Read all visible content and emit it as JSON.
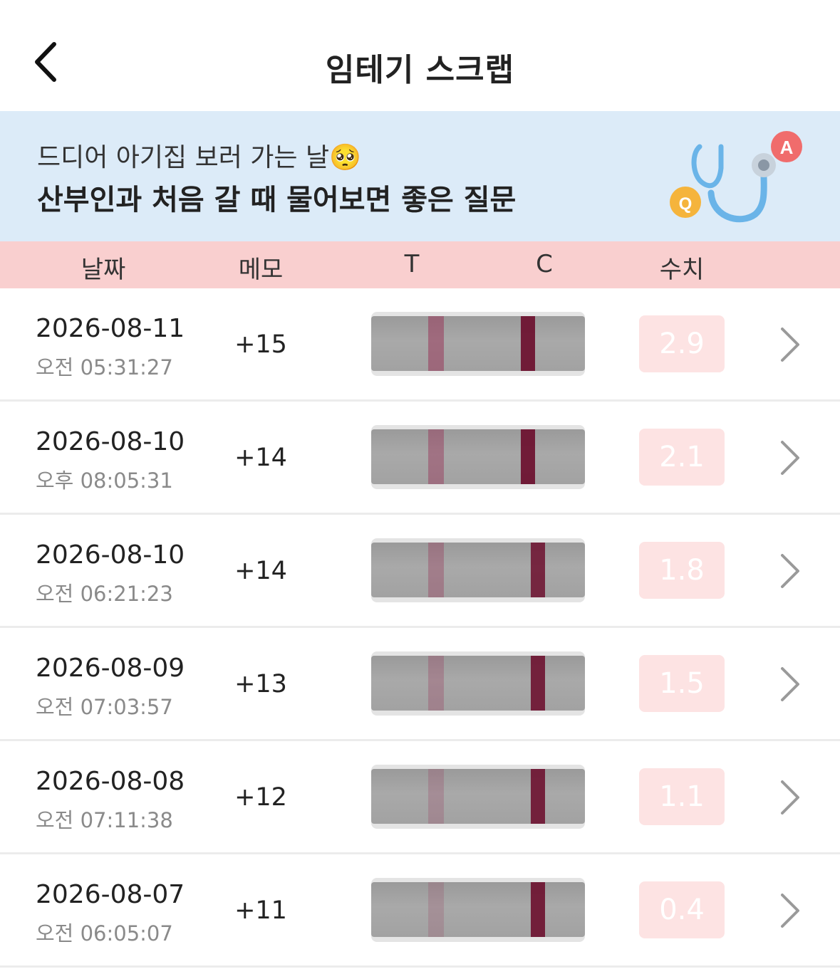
{
  "header": {
    "title": "임테기 스크랩",
    "back_icon": "chevron-left-icon"
  },
  "banner": {
    "subtitle": "드디어 아기집 보러 가는 날🥺",
    "title": "산부인과 처음 갈 때 물어보면 좋은 질문",
    "art": {
      "q_label": "Q",
      "a_label": "A",
      "icon": "stethoscope-icon"
    }
  },
  "table_header": {
    "date": "날짜",
    "memo": "메모",
    "t": "T",
    "c": "C",
    "value": "수치"
  },
  "colors": {
    "accent_pink": "#f9cfcf",
    "banner_blue": "#dcebf8",
    "badge": "#fde3e3",
    "control_line": "#7a1c3c"
  },
  "rows": [
    {
      "date": "2026-08-11",
      "time": "오전 05:31:27",
      "memo": "+15",
      "value": "2.9",
      "t_intensity": 0.55,
      "c_intensity": 1.0
    },
    {
      "date": "2026-08-10",
      "time": "오후 08:05:31",
      "memo": "+14",
      "value": "2.1",
      "t_intensity": 0.45,
      "c_intensity": 1.0
    },
    {
      "date": "2026-08-10",
      "time": "오전 06:21:23",
      "memo": "+14",
      "value": "1.8",
      "t_intensity": 0.3,
      "c_intensity": 0.85
    },
    {
      "date": "2026-08-09",
      "time": "오전 07:03:57",
      "memo": "+13",
      "value": "1.5",
      "t_intensity": 0.2,
      "c_intensity": 0.9
    },
    {
      "date": "2026-08-08",
      "time": "오전 07:11:38",
      "memo": "+12",
      "value": "1.1",
      "t_intensity": 0.1,
      "c_intensity": 0.9
    },
    {
      "date": "2026-08-07",
      "time": "오전 06:05:07",
      "memo": "+11",
      "value": "0.4",
      "t_intensity": 0.05,
      "c_intensity": 0.95
    }
  ]
}
